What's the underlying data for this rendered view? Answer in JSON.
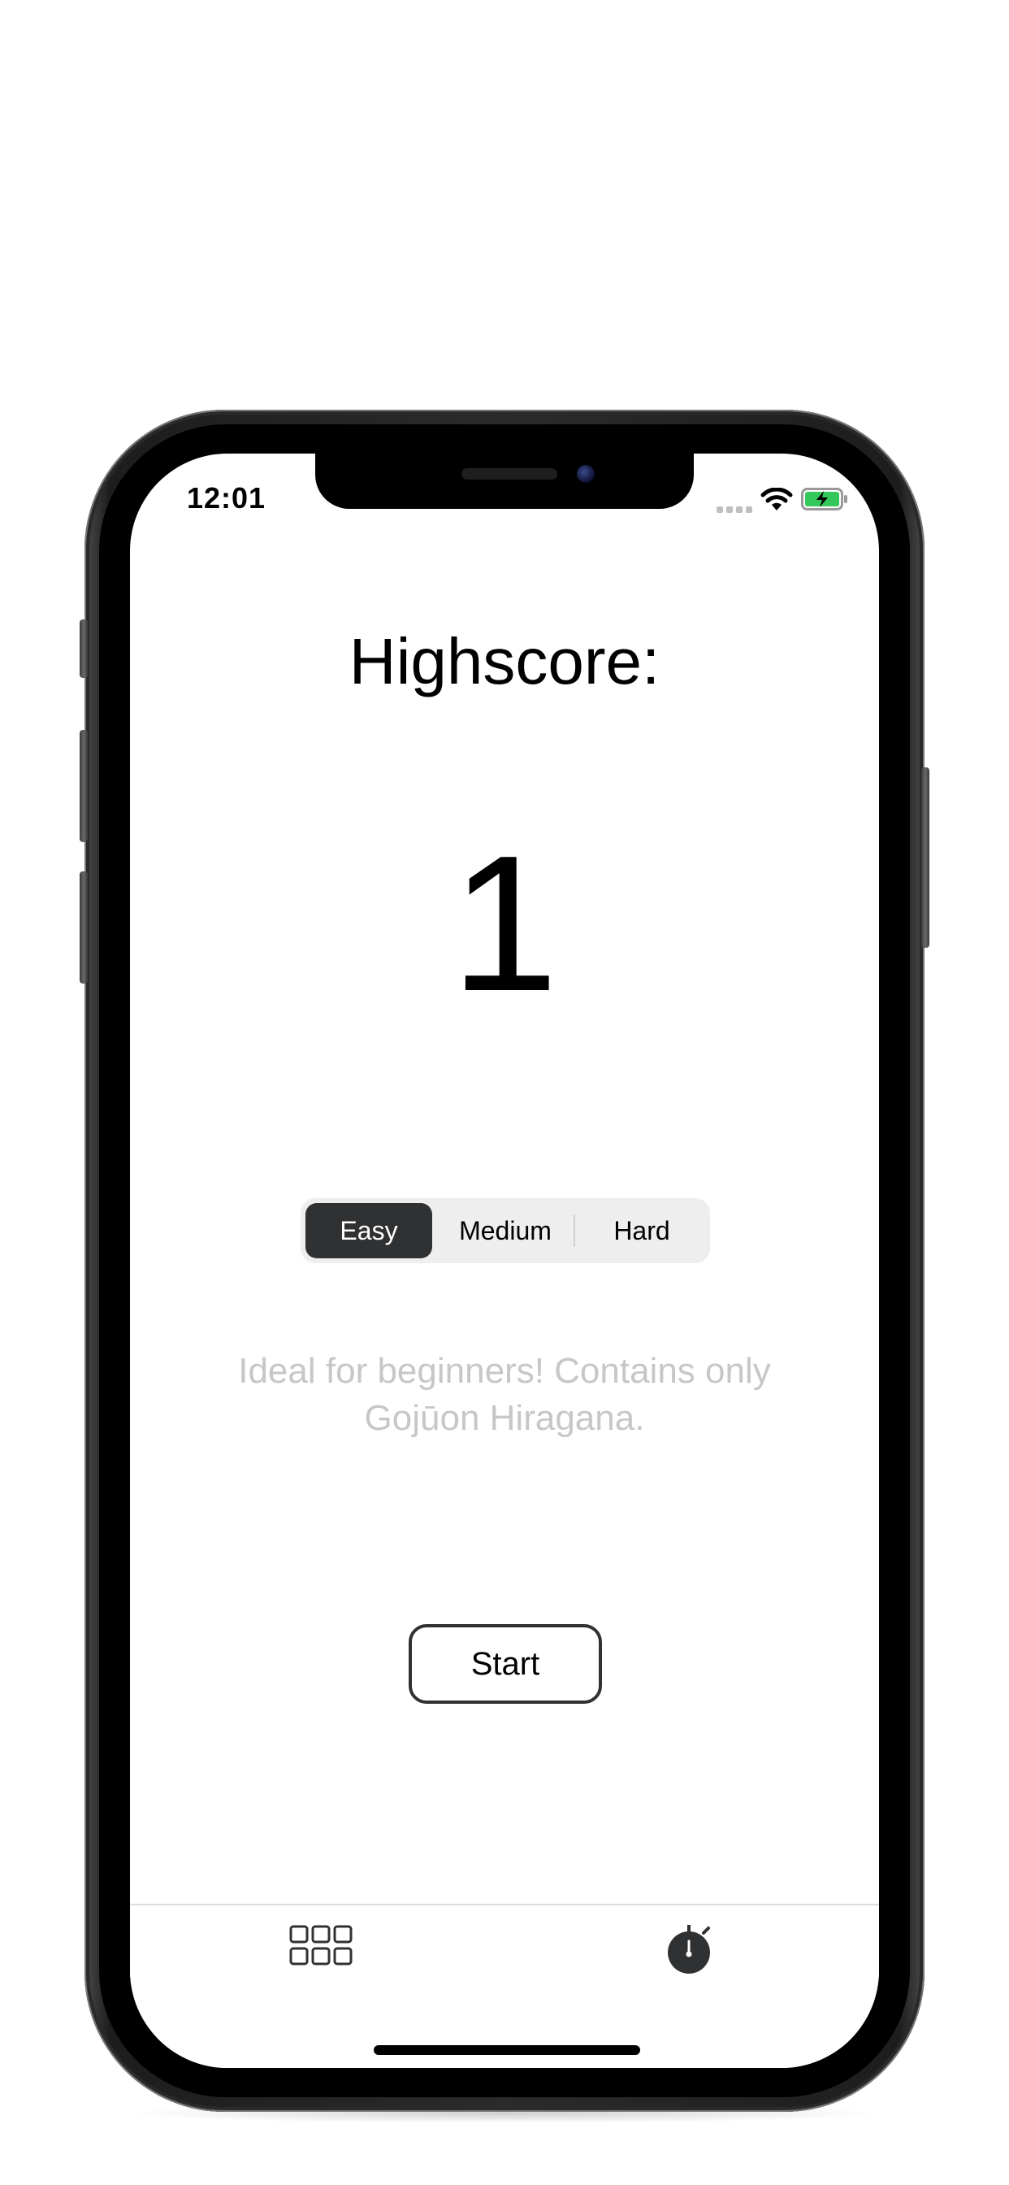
{
  "status_bar": {
    "time": "12:01",
    "icons": [
      "signal-icon",
      "wifi-icon",
      "battery-charging-icon"
    ]
  },
  "highscore": {
    "title": "Highscore:",
    "value": "1"
  },
  "difficulty": {
    "options": [
      "Easy",
      "Medium",
      "Hard"
    ],
    "selected": "Easy",
    "description": "Ideal for beginners! Contains only Gojūon Hiragana."
  },
  "start_button": {
    "label": "Start"
  },
  "tab_bar": {
    "items": [
      {
        "icon": "grid-icon",
        "selected": false
      },
      {
        "icon": "timer-icon",
        "selected": true
      }
    ]
  },
  "colors": {
    "selected_segment": "#303132",
    "description_text": "#c7c7c9",
    "battery_charge": "#34c759",
    "button_border": "#303132"
  }
}
